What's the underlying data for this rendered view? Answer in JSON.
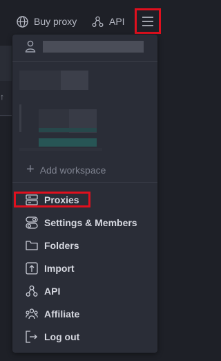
{
  "topbar": {
    "buy_proxy_label": "Buy proxy",
    "api_label": "API"
  },
  "dropdown": {
    "add_workspace_label": "Add workspace",
    "items": [
      {
        "label": "Proxies"
      },
      {
        "label": "Settings & Members"
      },
      {
        "label": "Folders"
      },
      {
        "label": "Import"
      },
      {
        "label": "API"
      },
      {
        "label": "Affiliate"
      },
      {
        "label": "Log out"
      }
    ]
  },
  "colors": {
    "background": "#1e2027",
    "panel": "#2a2d37",
    "highlight": "#e0101e"
  }
}
